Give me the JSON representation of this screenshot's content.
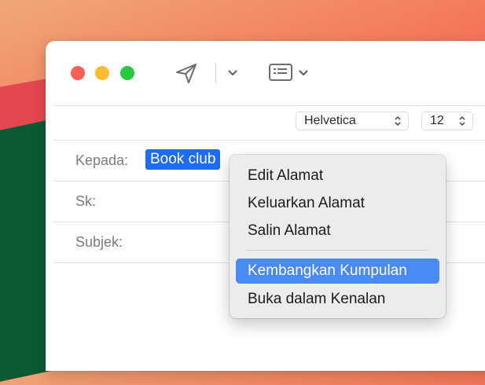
{
  "toolbar": {
    "send_icon": "paper-plane-icon",
    "send_menu_icon": "chevron-down-icon",
    "header_fields_icon": "header-fields-icon",
    "header_menu_icon": "chevron-down-icon"
  },
  "format_bar": {
    "font": "Helvetica",
    "size": "12"
  },
  "fields": {
    "to_label": "Kepada:",
    "cc_label": "Sk:",
    "subject_label": "Subjek:"
  },
  "recipient": {
    "name": "Book club"
  },
  "context_menu": {
    "items": [
      {
        "label": "Edit Alamat"
      },
      {
        "label": "Keluarkan Alamat"
      },
      {
        "label": "Salin Alamat"
      },
      {
        "label": "Kembangkan Kumpulan",
        "highlighted": true
      },
      {
        "label": "Buka dalam Kenalan"
      }
    ]
  },
  "colors": {
    "selection": "#1d6cf2",
    "menu_highlight": "#4a8af4",
    "close": "#fe5f57",
    "minimize": "#febc2e",
    "zoom": "#28c840"
  }
}
